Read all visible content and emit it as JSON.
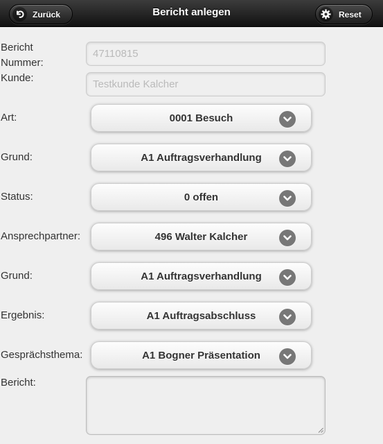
{
  "header": {
    "title": "Bericht anlegen",
    "back_label": "Zurück",
    "reset_label": "Reset"
  },
  "form": {
    "report_number": {
      "label": "Bericht Nummer:",
      "value": "47110815"
    },
    "customer": {
      "label": "Kunde:",
      "value": "Testkunde Kalcher"
    },
    "type": {
      "label": "Art:",
      "value": "0001 Besuch"
    },
    "reason1": {
      "label": "Grund:",
      "value": "A1 Auftragsverhandlung"
    },
    "status": {
      "label": "Status:",
      "value": "0 offen"
    },
    "contact": {
      "label": "Ansprechpartner:",
      "value": "496 Walter Kalcher"
    },
    "reason2": {
      "label": "Grund:",
      "value": "A1 Auftragsverhandlung"
    },
    "result": {
      "label": "Ergebnis:",
      "value": "A1 Auftragsabschluss"
    },
    "topic": {
      "label": "Gesprächsthema:",
      "value": "A1 Bogner Präsentation"
    },
    "report": {
      "label": "Bericht:",
      "value": ""
    }
  },
  "icons": {
    "back": "back-arrow-icon",
    "reset": "gear-icon",
    "dropdown": "chevron-down-icon"
  },
  "colors": {
    "header_bg": "#1d1d1d",
    "page_bg": "#efefef",
    "chevron_bg": "#777777"
  }
}
